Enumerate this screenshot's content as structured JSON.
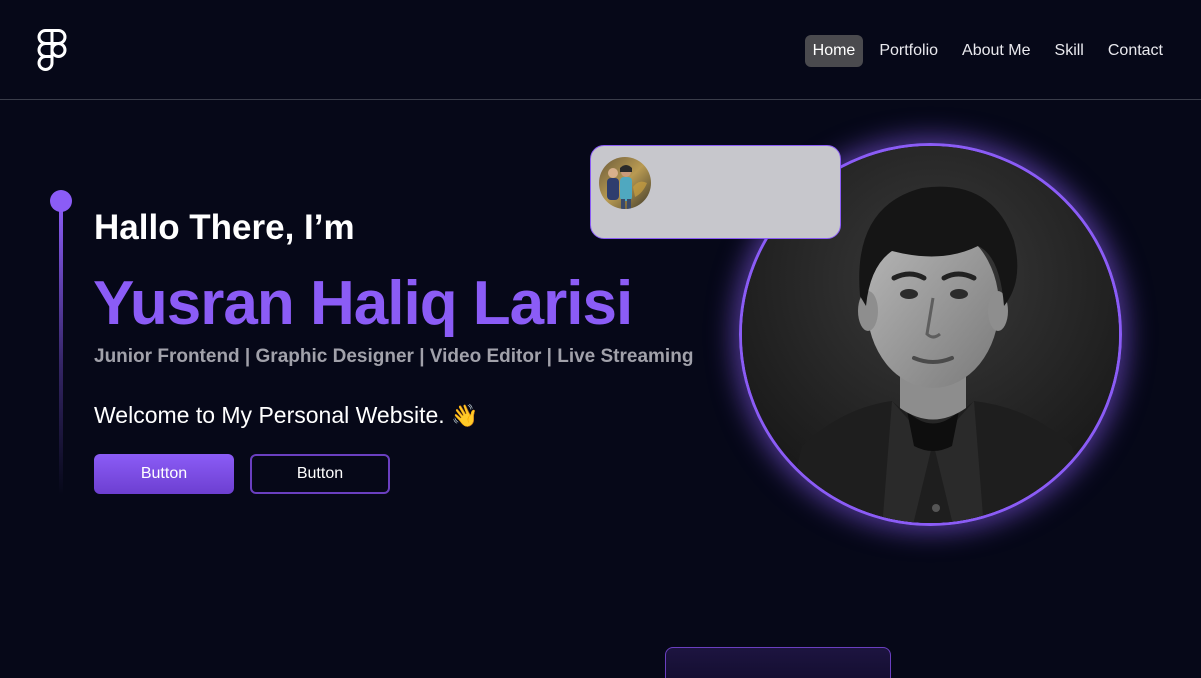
{
  "header": {
    "logo_icon": "figma-logo-icon",
    "nav": [
      {
        "label": "Home",
        "active": true
      },
      {
        "label": "Portfolio",
        "active": false
      },
      {
        "label": "About Me",
        "active": false
      },
      {
        "label": "Skill",
        "active": false
      },
      {
        "label": "Contact",
        "active": false
      }
    ]
  },
  "hero": {
    "greeting": "Hallo There, I’m",
    "name": "Yusran Haliq Larisi",
    "roles": "Junior Frontend | Graphic Designer | Video Editor | Live Streaming",
    "welcome": "Welcome to My Personal Website.",
    "welcome_emoji": "👋",
    "primary_button": "Button",
    "secondary_button": "Button"
  },
  "colors": {
    "background": "#060818",
    "accent": "#8b5cf6",
    "subtitle": "#a1a1aa",
    "nav_active_bg": "#4a4a4e"
  }
}
